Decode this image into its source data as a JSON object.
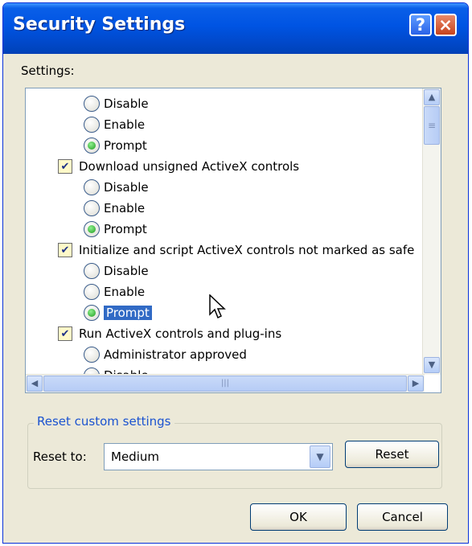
{
  "window": {
    "title": "Security Settings"
  },
  "titlebar": {
    "help_label": "?",
    "close_label": "×"
  },
  "settings": {
    "label": "Settings:",
    "items": [
      {
        "type": "option",
        "label": "Disable",
        "selected": false
      },
      {
        "type": "option",
        "label": "Enable",
        "selected": false
      },
      {
        "type": "option",
        "label": "Prompt",
        "selected": true
      },
      {
        "type": "category",
        "label": "Download unsigned ActiveX controls"
      },
      {
        "type": "option",
        "label": "Disable",
        "selected": false
      },
      {
        "type": "option",
        "label": "Enable",
        "selected": false
      },
      {
        "type": "option",
        "label": "Prompt",
        "selected": true
      },
      {
        "type": "category",
        "label": "Initialize and script ActiveX controls not marked as safe"
      },
      {
        "type": "option",
        "label": "Disable",
        "selected": false
      },
      {
        "type": "option",
        "label": "Enable",
        "selected": false
      },
      {
        "type": "option",
        "label": "Prompt",
        "selected": true,
        "highlighted": true
      },
      {
        "type": "category",
        "label": "Run ActiveX controls and plug-ins"
      },
      {
        "type": "option",
        "label": "Administrator approved",
        "selected": false
      },
      {
        "type": "option",
        "label": "Disable",
        "selected": false
      }
    ]
  },
  "reset": {
    "group_label": "Reset custom settings",
    "reset_to_label": "Reset to:",
    "selected_level": "Medium",
    "reset_button": "Reset"
  },
  "footer": {
    "ok_button": "OK",
    "cancel_button": "Cancel"
  },
  "icons": {
    "scroll_up": "▲",
    "scroll_down": "▼",
    "scroll_left": "◀",
    "scroll_right": "▶",
    "dropdown": "▼",
    "thumb_grip": "≡",
    "hthumb_grip": "|||",
    "setting_icon": "✔"
  },
  "colors": {
    "title_bar": "#0054e3",
    "selection": "#316ac5",
    "dialog_bg": "#ece9d8",
    "legend": "#1b53d0"
  }
}
